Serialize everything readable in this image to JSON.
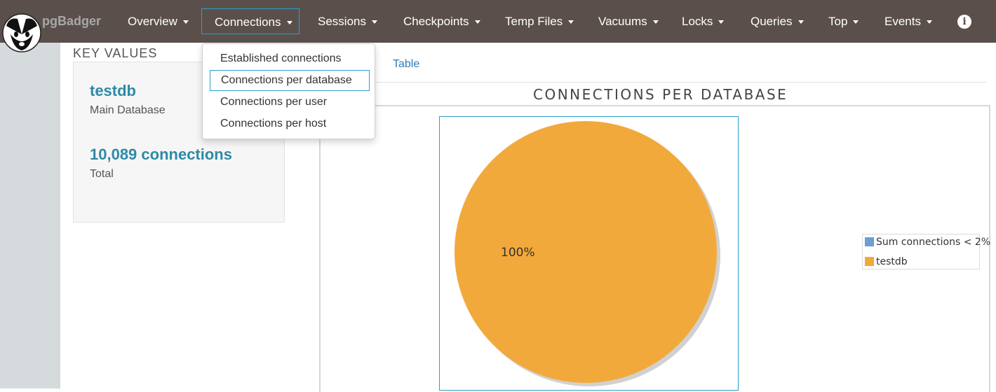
{
  "brand": "pgBadger",
  "nav": {
    "items": [
      {
        "label": "Overview"
      },
      {
        "label": "Connections"
      },
      {
        "label": "Sessions"
      },
      {
        "label": "Checkpoints"
      },
      {
        "label": "Temp Files"
      },
      {
        "label": "Vacuums"
      },
      {
        "label": "Locks"
      },
      {
        "label": "Queries"
      },
      {
        "label": "Top"
      },
      {
        "label": "Events"
      }
    ],
    "active": "Connections"
  },
  "dropdown": {
    "items": [
      {
        "label": "Established connections"
      },
      {
        "label": "Connections per database"
      },
      {
        "label": "Connections per user"
      },
      {
        "label": "Connections per host"
      }
    ],
    "selected": "Connections per database"
  },
  "key_values": {
    "title": "KEY VALUES",
    "main_db_value": "testdb",
    "main_db_label": "Main Database",
    "total_value": "10,089 connections",
    "total_label": "Total"
  },
  "tabs": {
    "table_label": "Table"
  },
  "chart": {
    "title": "CONNECTIONS PER DATABASE",
    "slice_label": "100%",
    "legend": [
      {
        "label": "Sum connections < 2%",
        "color": "#6a9fd0"
      },
      {
        "label": "testdb",
        "color": "#f2a93b"
      }
    ]
  },
  "chart_data": {
    "type": "pie",
    "title": "CONNECTIONS PER DATABASE",
    "categories": [
      "Sum connections < 2%",
      "testdb"
    ],
    "values": [
      0,
      100
    ],
    "legend_position": "right"
  },
  "colors": {
    "navbar": "#5b4f4b",
    "accent": "#2aa0c8",
    "pie_main": "#f2a93b",
    "key_value": "#2e8aa6"
  }
}
